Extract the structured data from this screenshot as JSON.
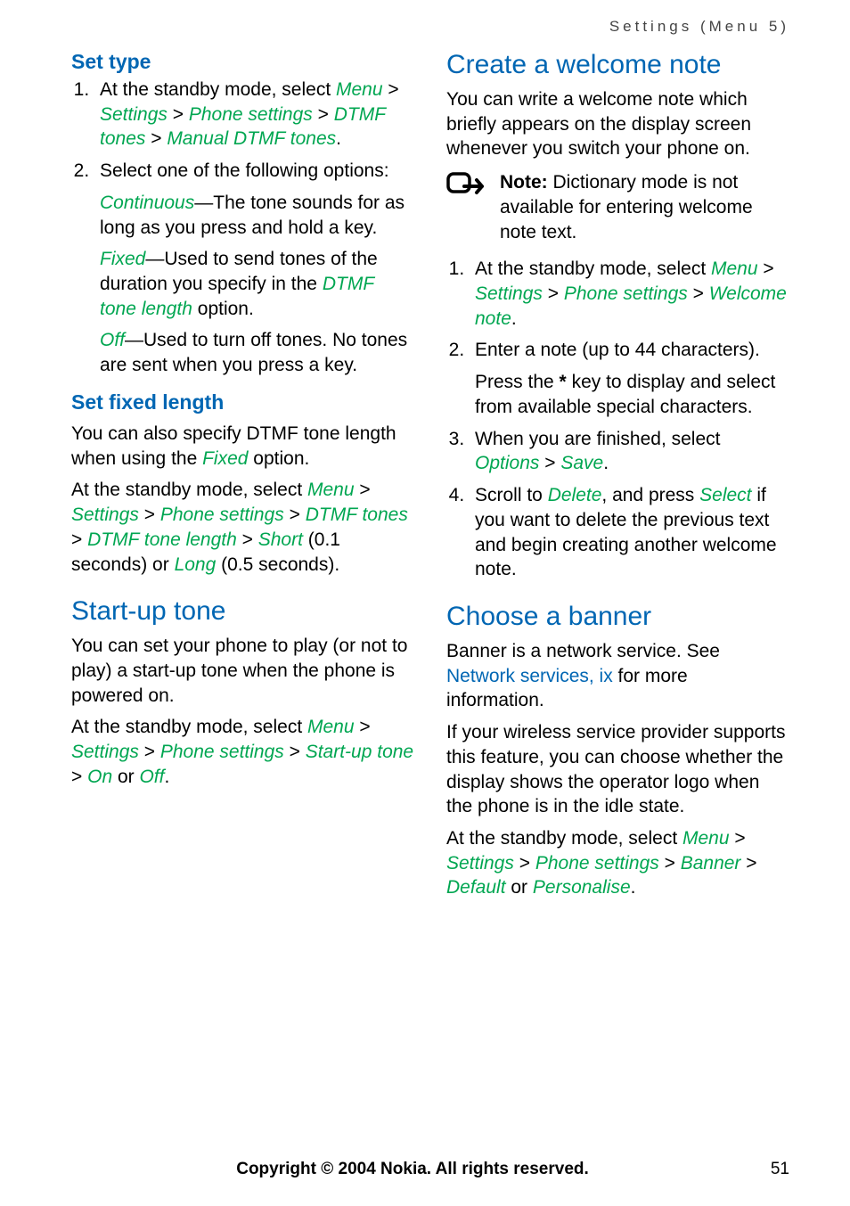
{
  "running_head": "Settings (Menu 5)",
  "left": {
    "set_type_h": "Set type",
    "li1_a": "At the standby mode, select ",
    "li1_path": [
      "Menu",
      "Settings",
      "Phone settings",
      "DTMF tones",
      "Manual DTMF tones"
    ],
    "li2": "Select one of the following options:",
    "opt1_t": "Continuous",
    "opt1_b": "—The tone sounds for as long as you press and hold a key.",
    "opt2_t": "Fixed",
    "opt2_b1": "—Used to send tones of the duration you specify in the ",
    "opt2_term": "DTMF tone length",
    "opt2_b2": " option.",
    "opt3_t": "Off",
    "opt3_b": "—Used to turn off tones. No tones are sent when you press a key.",
    "set_fixed_h": "Set fixed length",
    "fixed_p1a": "You can also specify DTMF tone length when using the ",
    "fixed_p1term": "Fixed",
    "fixed_p1b": " option.",
    "fixed_p2a": "At the standby mode, select ",
    "fixed_path": [
      "Menu",
      "Settings",
      "Phone settings",
      "DTMF tones",
      "DTMF tone length",
      "Short"
    ],
    "fixed_short_tail": " (0.1 seconds) or ",
    "fixed_long": "Long",
    "fixed_long_tail": " (0.5 seconds).",
    "startup_h": "Start-up tone",
    "startup_p1": "You can set your phone to play (or not to play) a start-up tone when the phone is powered on.",
    "startup_p2a": "At the standby mode, select ",
    "startup_path": [
      "Menu",
      "Settings",
      "Phone settings",
      "Start-up tone"
    ],
    "startup_on": "On",
    "startup_or": " or ",
    "startup_off": "Off",
    "startup_tail": "."
  },
  "right": {
    "welcome_h": "Create a welcome note",
    "welcome_p1": "You can write a welcome note which briefly appears on the display screen whenever you switch your phone on.",
    "note_label": "Note:",
    "note_body": " Dictionary mode is not available for entering welcome note text.",
    "w_li1a": "At the standby mode, select ",
    "w_li1_path": [
      "Menu",
      "Settings",
      "Phone settings",
      "Welcome note"
    ],
    "w_li2": "Enter a note (up to 44 characters).",
    "w_li2_sub_a": "Press the ",
    "w_li2_star": "*",
    "w_li2_sub_b": " key to display and select from available special characters.",
    "w_li3a": "When you are finished, select ",
    "w_li3_opt": "Options",
    "w_li3_save": "Save",
    "w_li3_tail": ".",
    "w_li4a": "Scroll to ",
    "w_li4_del": "Delete",
    "w_li4b": ", and press ",
    "w_li4_sel": "Select",
    "w_li4c": " if you want to delete the previous text and begin creating another welcome note.",
    "banner_h": "Choose a banner",
    "banner_p1a": "Banner is a network service. See ",
    "banner_link": "Network services, ix",
    "banner_p1b": " for more information.",
    "banner_p2": "If your wireless service provider supports this feature, you can choose whether the display shows the operator logo when the phone is in the idle state.",
    "banner_p3a": "At the standby mode, select ",
    "banner_path": [
      "Menu",
      "Settings",
      "Phone settings",
      "Banner"
    ],
    "banner_def": "Default",
    "banner_or": " or ",
    "banner_pers": "Personalise",
    "banner_tail": "."
  },
  "footer": {
    "copyright": "Copyright © 2004 Nokia. All rights reserved.",
    "page": "51"
  }
}
